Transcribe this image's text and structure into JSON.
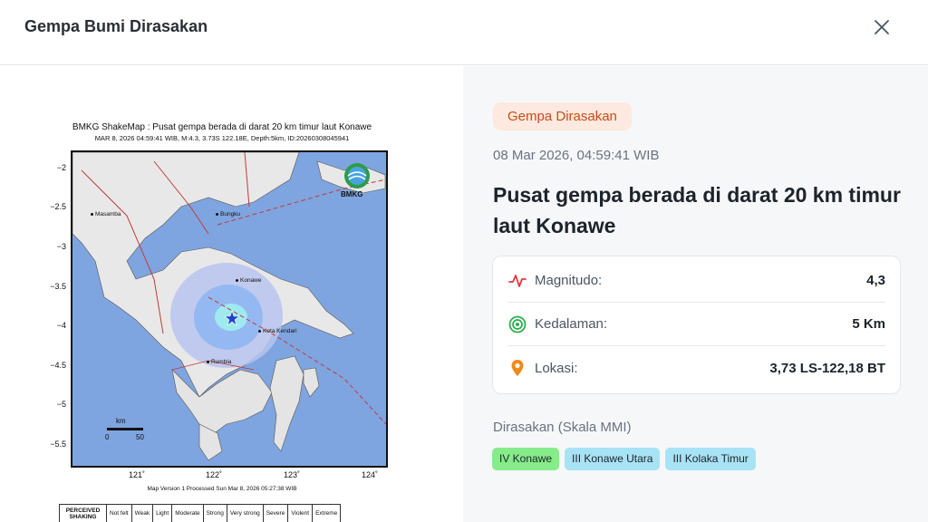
{
  "header": {
    "title": "Gempa Bumi Dirasakan"
  },
  "map": {
    "title": "BMKG ShakeMap : Pusat gempa berada di darat 20 km timur laut Konawe",
    "subtitle": "MAR 8, 2026 04:59:41 WIB, M:4.3, 3.73S 122.18E, Depth:5km, ID:20260308045941",
    "yticks": [
      "−2",
      "−2.5",
      "−3",
      "−3.5",
      "−4",
      "−4.5",
      "−5",
      "−5.5"
    ],
    "xticks": [
      "121˚",
      "122˚",
      "123˚",
      "124˚"
    ],
    "places": [
      "Masamba",
      "Bungku",
      "Konawe",
      "Kota Kendari",
      "Rumbia"
    ],
    "logo_text": "BMKG",
    "scale_unit": "km",
    "scale_start": "0",
    "scale_end": "50",
    "version": "Map Version 1 Processed Sun Mar  8, 2026 05:27:38 WIB",
    "shaking_header": "PERCEIVED SHAKING",
    "shaking_levels": [
      "Not felt",
      "Weak",
      "Light",
      "Moderate",
      "Strong",
      "Very strong",
      "Severe",
      "Violent",
      "Extreme"
    ]
  },
  "detail": {
    "tag": "Gempa Dirasakan",
    "datetime": "08 Mar 2026, 04:59:41 WIB",
    "headline": "Pusat gempa berada di darat 20 km timur laut Konawe",
    "magnitude_label": "Magnitudo:",
    "magnitude_value": "4,3",
    "depth_label": "Kedalaman:",
    "depth_value": "5 Km",
    "location_label": "Lokasi:",
    "location_value": "3,73 LS-122,18 BT",
    "felt_title": "Dirasakan (Skala MMI)",
    "felt": [
      {
        "label": "IV Konawe",
        "color": "#86ec8a"
      },
      {
        "label": "III Konawe Utara",
        "color": "#a8e3f5"
      },
      {
        "label": "III Kolaka Timur",
        "color": "#a8e3f5"
      }
    ]
  },
  "colors": {
    "accent_orange": "#cc4a16",
    "tag_bg": "#fde9df",
    "magnitude_icon": "#e0393e",
    "depth_icon": "#2eae4f",
    "location_icon": "#f28a1b"
  }
}
